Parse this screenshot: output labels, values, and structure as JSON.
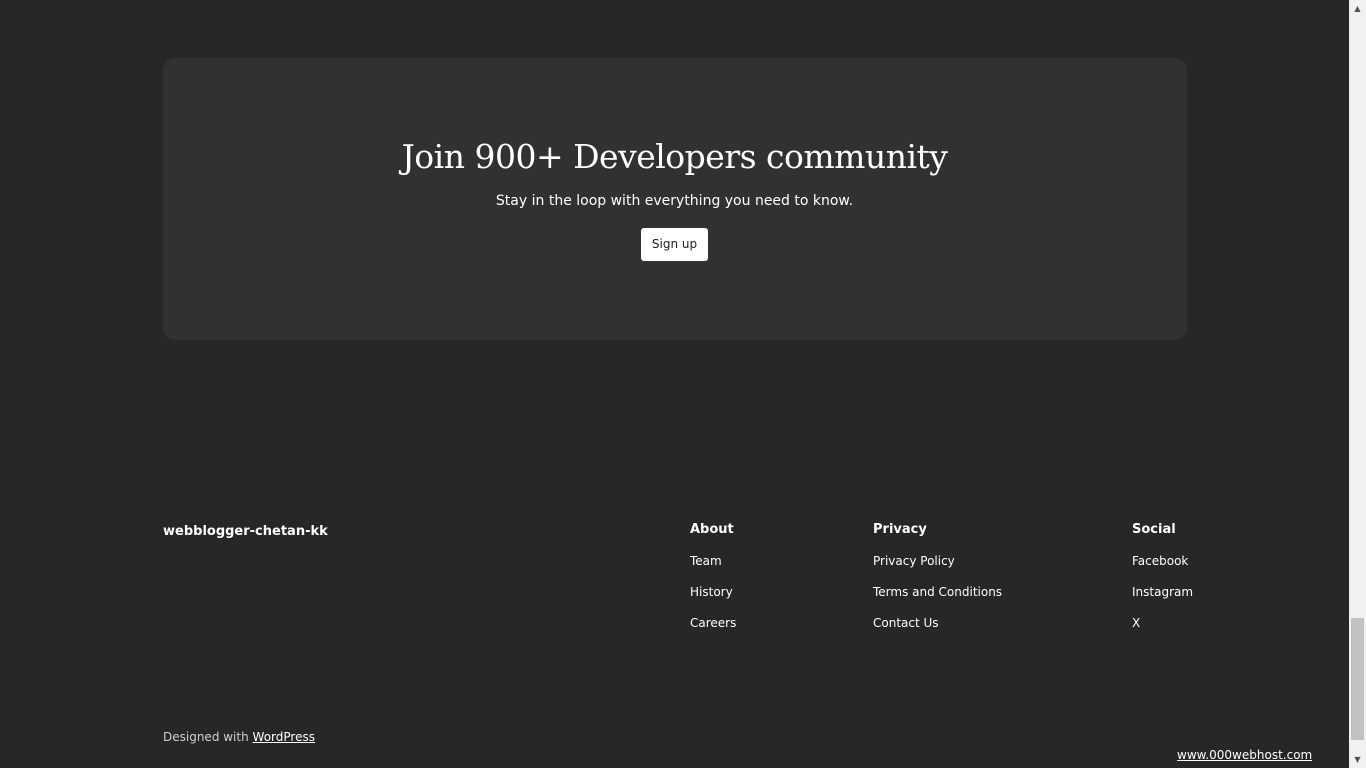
{
  "cta": {
    "title": "Join 900+ Developers community",
    "subtitle": "Stay in the loop with everything you need to know.",
    "button_label": "Sign up"
  },
  "footer": {
    "site_title": "webblogger-chetan-kk",
    "columns": [
      {
        "heading": "About",
        "links": [
          "Team",
          "History",
          "Careers"
        ]
      },
      {
        "heading": "Privacy",
        "links": [
          "Privacy Policy",
          "Terms and Conditions",
          "Contact Us"
        ]
      },
      {
        "heading": "Social",
        "links": [
          "Facebook",
          "Instagram",
          "X"
        ]
      }
    ],
    "credit_prefix": "Designed with ",
    "credit_link": "WordPress"
  },
  "host_badge": {
    "alt_text": "www.000webhost.com"
  },
  "scrollbar": {
    "up_icon": "arrow-up-icon",
    "down_icon": "arrow-down-icon",
    "up_glyph": "▲",
    "down_glyph": "▼"
  },
  "colors": {
    "page_bg": "#272727",
    "card_bg": "#313131",
    "button_bg": "#ffffff",
    "text": "#ffffff"
  }
}
